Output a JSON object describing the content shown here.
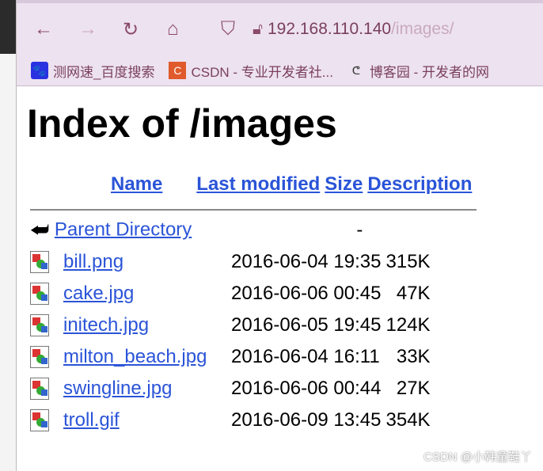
{
  "nav": {
    "back": "←",
    "forward": "→",
    "reload": "↻",
    "home": "⌂",
    "shield": "⛉",
    "url_host": "192.168.110.140",
    "url_path": "/images/"
  },
  "bookmarks": [
    {
      "label": "测网速_百度搜索",
      "icon": "baidu-icon",
      "color": "#2932e1"
    },
    {
      "label": "CSDN - 专业开发者社...",
      "icon": "csdn-icon",
      "color": "#e05a2b"
    },
    {
      "label": "博客园 - 开发者的网",
      "icon": "cnblogs-icon"
    }
  ],
  "page": {
    "title": "Index of /images",
    "columns": [
      "Name",
      "Last modified",
      "Size",
      "Description"
    ],
    "parent": {
      "name": "Parent Directory",
      "size": "-"
    },
    "files": [
      {
        "name": "bill.png",
        "modified": "2016-06-04 19:35",
        "size": "315K"
      },
      {
        "name": "cake.jpg",
        "modified": "2016-06-06 00:45",
        "size": "47K"
      },
      {
        "name": "initech.jpg",
        "modified": "2016-06-05 19:45",
        "size": "124K"
      },
      {
        "name": "milton_beach.jpg",
        "modified": "2016-06-04 16:11",
        "size": "33K"
      },
      {
        "name": "swingline.jpg",
        "modified": "2016-06-06 00:44",
        "size": "27K"
      },
      {
        "name": "troll.gif",
        "modified": "2016-06-09 13:45",
        "size": "354K"
      }
    ]
  },
  "watermark": "CSDN @小韩童鞋丫"
}
